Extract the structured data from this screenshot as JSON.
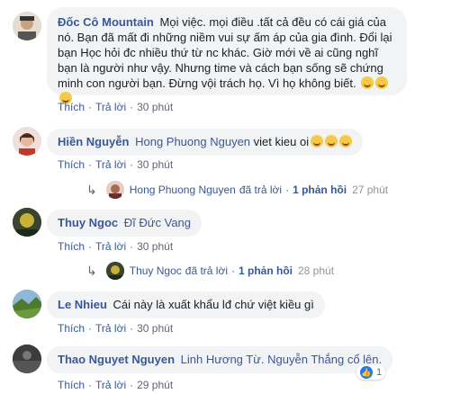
{
  "comments": [
    {
      "author": "Đốc Cô Mountain",
      "text": "Mọi việc. mọi điều .tất cả đều có cái giá của nó. Bạn đã mất đi những niềm vui sự ấm áp của gia đình. Đổi lại bạn Học hỏi đc nhiều thứ từ nc khác. Giờ mới về ai cũng nghĩ bạn là người như vậy. Nhưng time và cách bạn sống sẽ chứng minh con người bạn. Đừng vội trách họ. Vì họ không biết.",
      "emojis": [
        "smile-emoji",
        "smile-emoji",
        "smile-emoji"
      ],
      "like": "Thích",
      "reply": "Trả lời",
      "time": "30 phút"
    },
    {
      "author": "Hiền Nguyễn",
      "tag": "Hong Phuong Nguyen",
      "text": "viet kieu oi",
      "emojis": [
        "laugh-emoji",
        "laugh-emoji",
        "laugh-emoji"
      ],
      "like": "Thích",
      "reply": "Trả lời",
      "time": "30 phút",
      "replies": {
        "name": "Hong Phuong Nguyen",
        "action": "đã trả lời",
        "count": "1 phản hồi",
        "time": "27 phút"
      }
    },
    {
      "author": "Thuy Ngoc",
      "tag": "Đĩ Đức Vang",
      "text": "",
      "like": "Thích",
      "reply": "Trả lời",
      "time": "30 phút",
      "replies": {
        "name": "Thuy Ngoc",
        "action": "đã trả lời",
        "count": "1 phản hồi",
        "time": "28 phút"
      }
    },
    {
      "author": "Le Nhieu",
      "text": "Cái này là xuất khẩu lđ chứ việt kiều gì",
      "like": "Thích",
      "reply": "Trả lời",
      "time": "30 phút"
    },
    {
      "author": "Thao Nguyet Nguyen",
      "tag": "Linh Hương Từ.",
      "text": "Nguyễn Thắng cổ lên.",
      "like": "Thích",
      "reply": "Trả lời",
      "time": "29 phút",
      "reaction_count": "1"
    }
  ],
  "separator": "·",
  "colors": {
    "link": "#385898",
    "bubble": "#f2f3f5",
    "meta": "#606770"
  }
}
